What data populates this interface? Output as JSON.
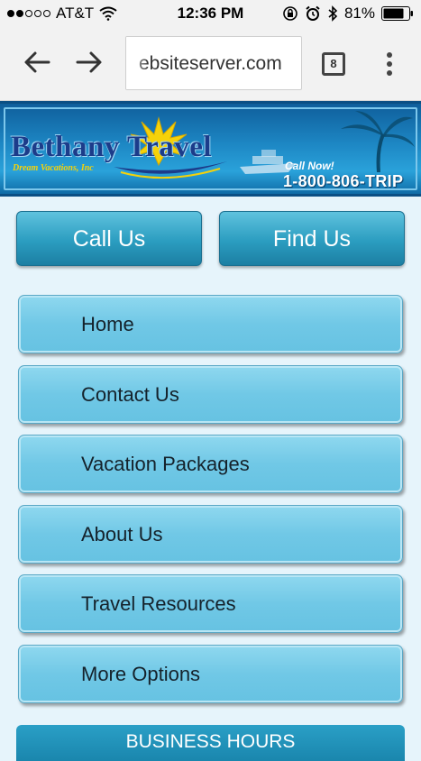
{
  "status_bar": {
    "carrier": "AT&T",
    "time": "12:36 PM",
    "battery": "81%",
    "signal_bars_filled": 2,
    "signal_bars_total": 5
  },
  "browser": {
    "url": "ebsiteserver.com",
    "tab_count": "8"
  },
  "banner": {
    "logo_title": "Bethany Travel",
    "logo_subtitle": "Dream Vacations, Inc",
    "call_now": "Call Now!",
    "phone": "1-800-806-TRIP"
  },
  "actions": {
    "call_label": "Call Us",
    "find_label": "Find Us"
  },
  "menu": {
    "items": [
      {
        "label": "Home"
      },
      {
        "label": "Contact Us"
      },
      {
        "label": "Vacation Packages"
      },
      {
        "label": "About Us"
      },
      {
        "label": "Travel Resources"
      },
      {
        "label": "More Options"
      }
    ]
  },
  "footer": {
    "hours_label": "BUSINESS HOURS"
  },
  "colors": {
    "accent": "#2b9dc0",
    "menu_item": "#70c8e6",
    "page_bg": "#e6f4fb"
  }
}
